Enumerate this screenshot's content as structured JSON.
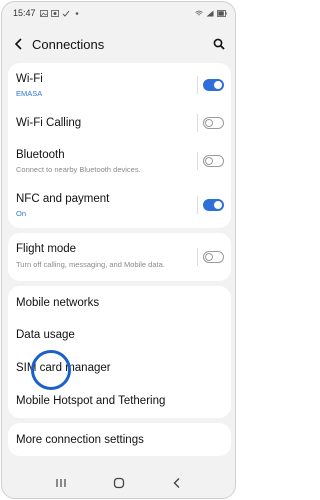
{
  "status_bar": {
    "time": "15:47"
  },
  "header": {
    "title": "Connections",
    "back_icon": "back-arrow-icon",
    "search_icon": "search-icon"
  },
  "settings": {
    "wifi": {
      "label": "Wi-Fi",
      "sub": "EMASA",
      "toggle": "on"
    },
    "wifi_calling": {
      "label": "Wi-Fi Calling",
      "toggle": "off"
    },
    "bluetooth": {
      "label": "Bluetooth",
      "sub": "Connect to nearby Bluetooth devices.",
      "toggle": "off"
    },
    "nfc": {
      "label": "NFC and payment",
      "sub": "On",
      "toggle": "on"
    },
    "flight_mode": {
      "label": "Flight mode",
      "sub": "Turn off calling, messaging, and Mobile data.",
      "toggle": "off"
    },
    "mobile_networks": {
      "label": "Mobile networks"
    },
    "data_usage": {
      "label": "Data usage"
    },
    "sim_manager": {
      "label": "SIM card manager"
    },
    "hotspot": {
      "label": "Mobile Hotspot and Tethering"
    },
    "more": {
      "label": "More connection settings"
    }
  },
  "colors": {
    "accent": "#2f6fd8",
    "highlight_ring": "#1d5fc9",
    "background": "#f2f2f2"
  }
}
